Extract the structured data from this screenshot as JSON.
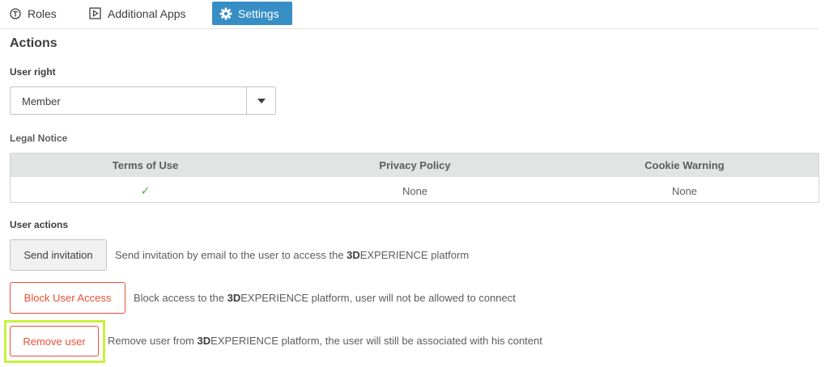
{
  "tabs": [
    {
      "label": "Roles",
      "icon": "roles-icon"
    },
    {
      "label": "Additional Apps",
      "icon": "play-box-icon"
    },
    {
      "label": "Settings",
      "icon": "gear-icon",
      "active": true
    }
  ],
  "actions": {
    "title": "Actions",
    "user_right": {
      "label": "User right",
      "selected": "Member"
    },
    "legal_notice": {
      "label": "Legal Notice",
      "columns": [
        "Terms of Use",
        "Privacy Policy",
        "Cookie Warning"
      ],
      "row": {
        "terms_of_use": "✓",
        "privacy_policy": "None",
        "cookie_warning": "None"
      }
    },
    "user_actions": {
      "label": "User actions",
      "items": [
        {
          "button": "Send invitation",
          "desc_before": "Send invitation by email to the user to access the ",
          "brand_bold": "3D",
          "brand_rest": "EXPERIENCE",
          "desc_after": " platform"
        },
        {
          "button": "Block User Access",
          "desc_before": "Block access to the ",
          "brand_bold": "3D",
          "brand_rest": "EXPERIENCE",
          "desc_after": " platform, user will not be allowed to connect"
        },
        {
          "button": "Remove user",
          "desc_before": "Remove user from ",
          "brand_bold": "3D",
          "brand_rest": "EXPERIENCE",
          "desc_after": " platform, the user will still be associated with his content"
        }
      ]
    }
  },
  "colors": {
    "accent": "#368ec4",
    "danger": "#ea4f37",
    "check": "#57b847",
    "highlight": "#c8f23c"
  }
}
